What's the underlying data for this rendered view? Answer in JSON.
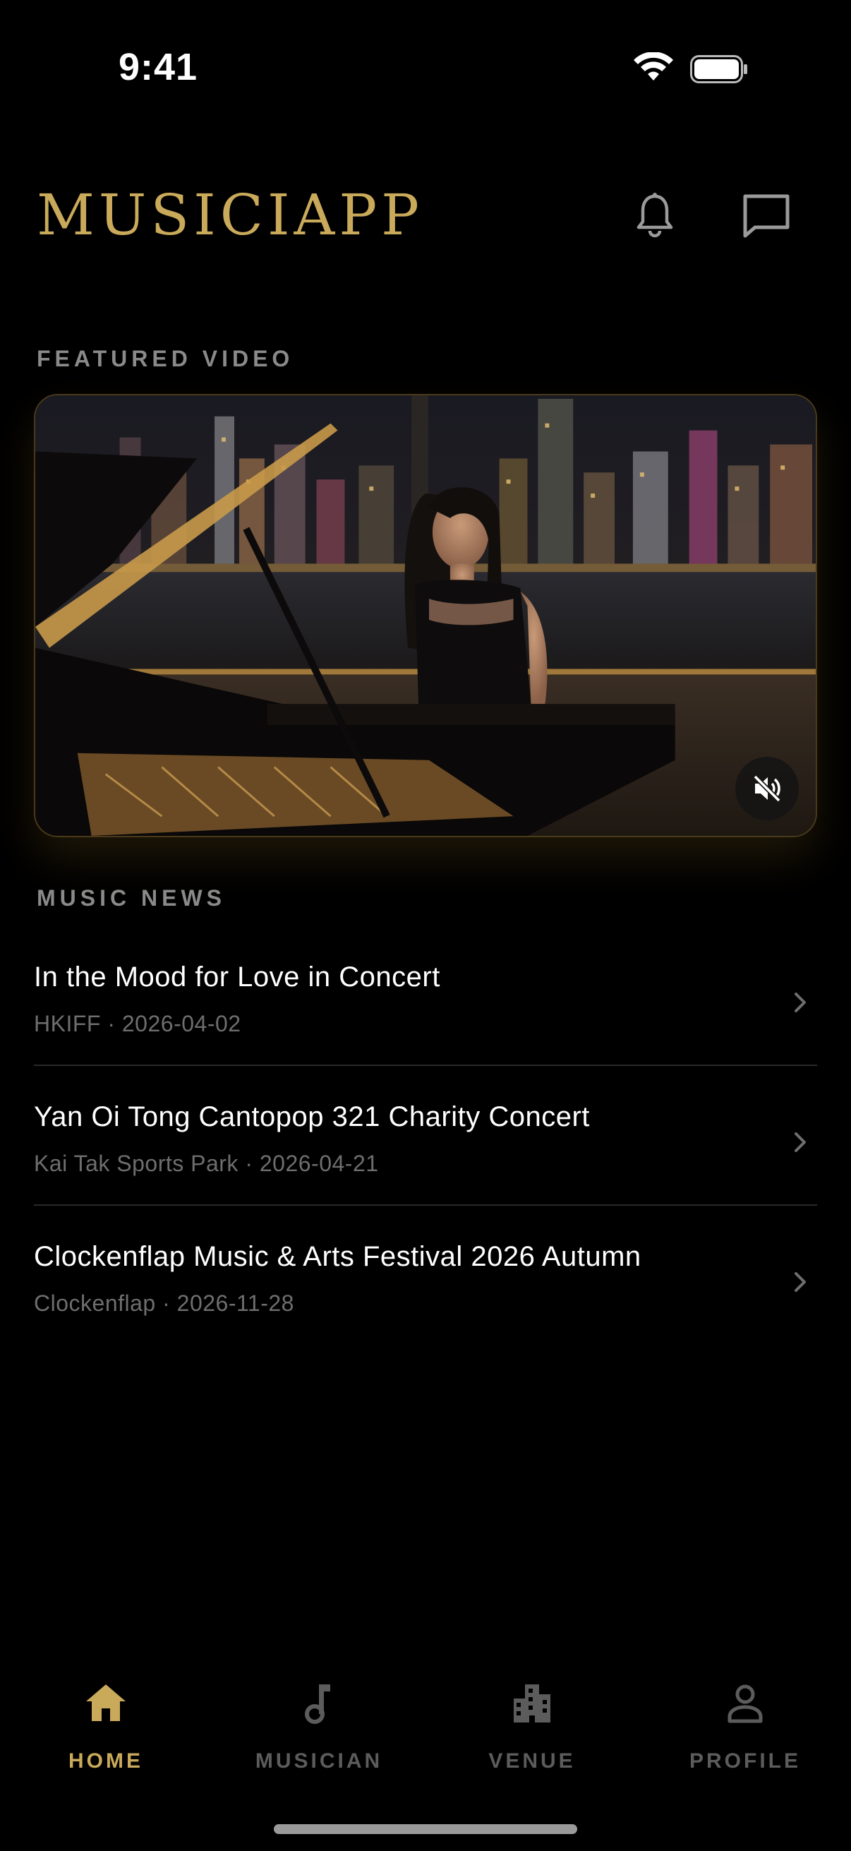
{
  "status_bar": {
    "time": "9:41"
  },
  "header": {
    "logo": "MUSICIAPP",
    "bell_icon": "bell-icon",
    "chat_icon": "chat-icon"
  },
  "featured": {
    "label": "FEATURED VIDEO",
    "mute_icon": "volume-muted-icon"
  },
  "news": {
    "label": "MUSIC NEWS",
    "items": [
      {
        "title": "In the Mood for Love in Concert",
        "meta": "HKIFF · 2026-04-02"
      },
      {
        "title": "Yan Oi Tong Cantopop 321 Charity Concert",
        "meta": "Kai Tak Sports Park · 2026-04-21"
      },
      {
        "title": "Clockenflap Music & Arts Festival 2026 Autumn",
        "meta": "Clockenflap · 2026-11-28"
      }
    ]
  },
  "tabs": [
    {
      "label": "HOME",
      "icon": "home-icon",
      "active": true
    },
    {
      "label": "MUSICIAN",
      "icon": "music-note-icon",
      "active": false
    },
    {
      "label": "VENUE",
      "icon": "building-icon",
      "active": false
    },
    {
      "label": "PROFILE",
      "icon": "person-icon",
      "active": false
    }
  ],
  "colors": {
    "accent": "#c9a95a",
    "background": "#000000",
    "muted_text": "#6e6e6e"
  }
}
